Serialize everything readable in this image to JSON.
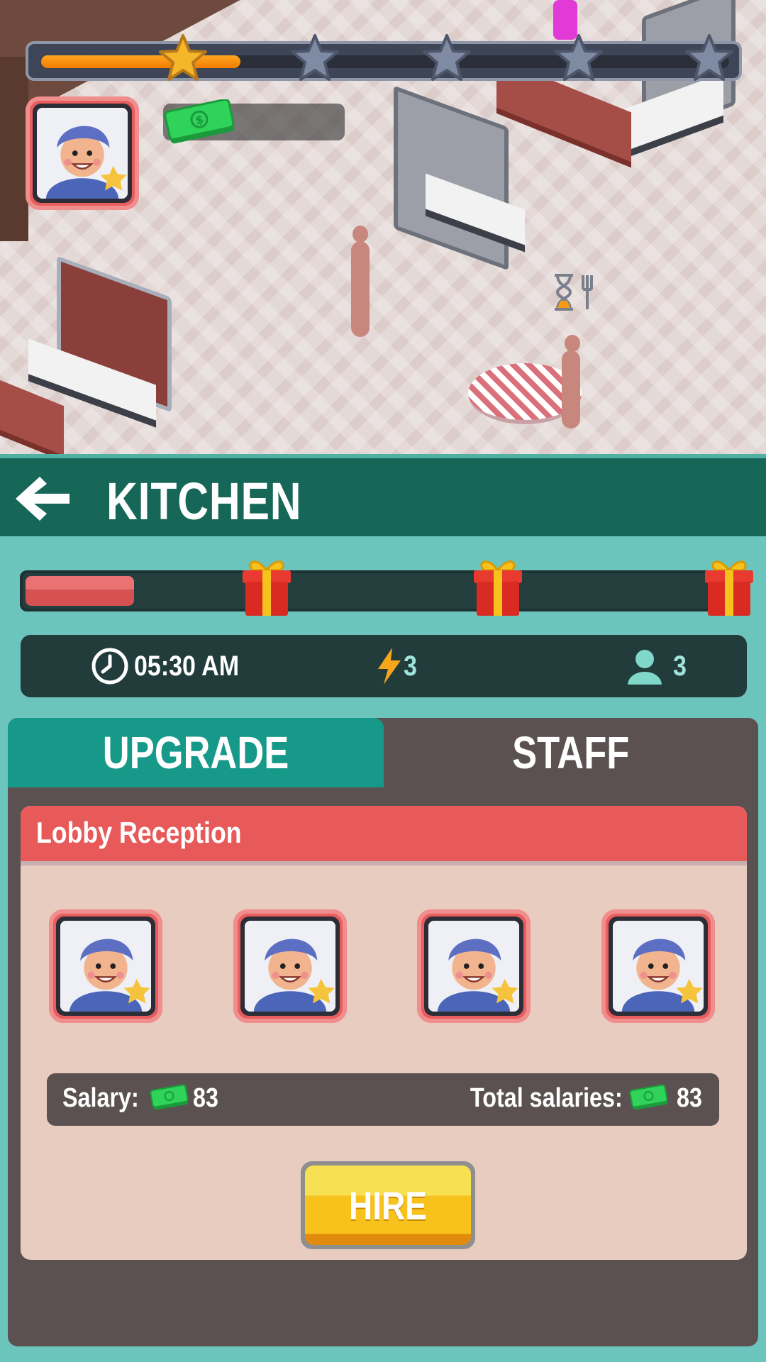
{
  "hud": {
    "star_progress": 0.29,
    "stars_total": 5,
    "stars_earned": 1,
    "cash_value": ""
  },
  "header": {
    "title": "KITCHEN"
  },
  "reward_track": {
    "progress": 0.15,
    "gift_count": 3
  },
  "stats": {
    "time": "05:30 AM",
    "energy": "3",
    "staff_count": "3"
  },
  "tabs": [
    {
      "label": "UPGRADE"
    },
    {
      "label": "STAFF"
    }
  ],
  "staff_card": {
    "title": "Lobby Reception",
    "staff_slots": 4,
    "salary_label": "Salary:",
    "salary_value": "83",
    "total_label": "Total salaries:",
    "total_value": "83",
    "hire_label": "HIRE"
  },
  "colors": {
    "header_bg": "#176758",
    "accent_red": "#e85a5a",
    "tab_active": "#17998a",
    "hire_yellow": "#f7c21c"
  }
}
